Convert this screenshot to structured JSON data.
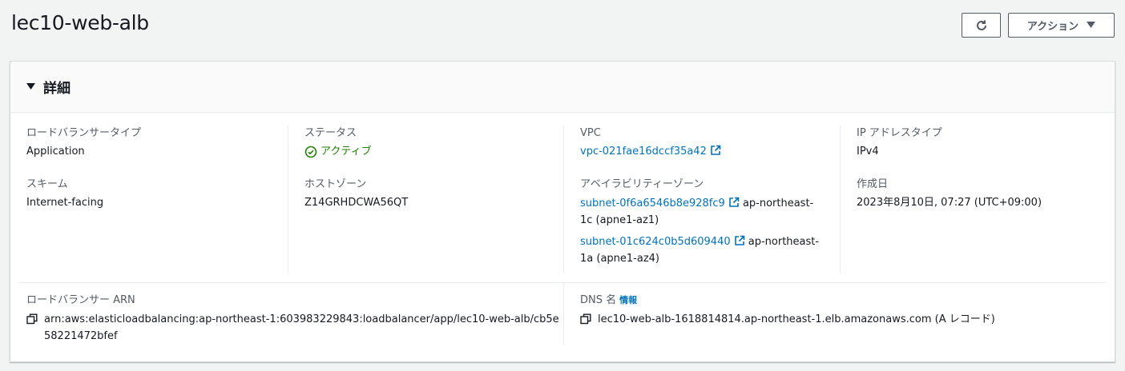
{
  "page": {
    "title": "lec10-web-alb"
  },
  "toolbar": {
    "action_label": "アクション"
  },
  "details": {
    "header": "詳細",
    "lb_type": {
      "label": "ロードバランサータイプ",
      "value": "Application"
    },
    "scheme": {
      "label": "スキーム",
      "value": "Internet-facing"
    },
    "status": {
      "label": "ステータス",
      "value": "アクティブ"
    },
    "hosted_zone": {
      "label": "ホストゾーン",
      "value": "Z14GRHDCWA56QT"
    },
    "vpc": {
      "label": "VPC",
      "value": "vpc-021fae16dccf35a42"
    },
    "az": {
      "label": "アベイラビリティーゾーン",
      "subnets": [
        {
          "id": "subnet-0f6a6546b8e928fc9",
          "zone": "ap-northeast-1c (apne1-az1)"
        },
        {
          "id": "subnet-01c624c0b5d609440",
          "zone": "ap-northeast-1a (apne1-az4)"
        }
      ]
    },
    "ip_type": {
      "label": "IP アドレスタイプ",
      "value": "IPv4"
    },
    "created": {
      "label": "作成日",
      "value": "2023年8月10日, 07:27 (UTC+09:00)"
    },
    "arn": {
      "label": "ロードバランサー ARN",
      "value": "arn:aws:elasticloadbalancing:ap-northeast-1:603983229843:loadbalancer/app/lec10-web-alb/cb5e58221472bfef"
    },
    "dns": {
      "label": "DNS 名",
      "info": "情報",
      "value": "lec10-web-alb-1618814814.ap-northeast-1.elb.amazonaws.com (A レコード)"
    }
  },
  "colors": {
    "link": "#0073bb",
    "success": "#1d8102",
    "border": "#545b64"
  },
  "icons": [
    "refresh-icon",
    "caret-down-icon",
    "check-circle-icon",
    "external-link-icon",
    "copy-icon"
  ]
}
